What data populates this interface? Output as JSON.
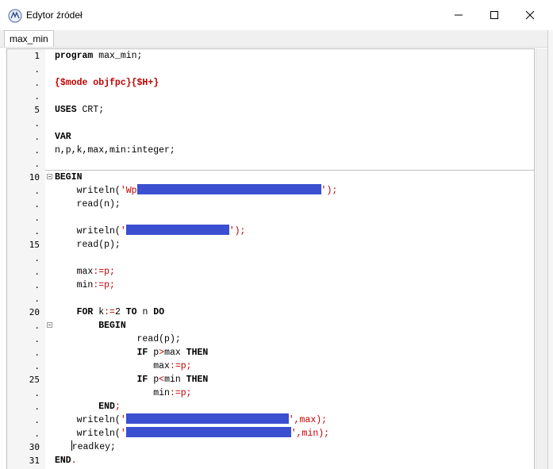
{
  "window": {
    "title": "Edytor źródeł",
    "tab": "max_min",
    "icon": "lazarus-icon"
  },
  "editor": {
    "line_numbers": [
      "1",
      ".",
      ".",
      ".",
      "5",
      ".",
      ".",
      ".",
      ".",
      "10",
      ".",
      ".",
      ".",
      ".",
      "15",
      ".",
      ".",
      ".",
      ".",
      "20",
      ".",
      ".",
      ".",
      ".",
      "25",
      ".",
      ".",
      ".",
      ".",
      "30",
      "31"
    ],
    "code": {
      "l1": {
        "kw": "program",
        "rest": " max_min;"
      },
      "l3": {
        "dir": "{$mode objfpc}{$H+}"
      },
      "l5": {
        "kw": "USES",
        "rest": " CRT;"
      },
      "l7": {
        "kw": "VAR"
      },
      "l8": {
        "a": "n,p,k,max,min",
        "b": ":integer;"
      },
      "l10": {
        "kw": "BEGIN"
      },
      "l11": {
        "a": "writeln(",
        "b": "'Wp",
        "c": "');"
      },
      "l12": {
        "a": "read(n);"
      },
      "l14": {
        "a": "writeln(",
        "b": "'",
        "c": "');"
      },
      "l15": {
        "a": "read(p);"
      },
      "l17": {
        "a": "max",
        "b": ":=p;"
      },
      "l18": {
        "a": "min",
        "b": ":=p;"
      },
      "l20": {
        "kw1": "FOR",
        "a": " k",
        "b": ":=",
        "c": "2 ",
        "kw2": "TO",
        "d": " n ",
        "kw3": "DO"
      },
      "l21": {
        "kw": "BEGIN"
      },
      "l22": {
        "a": "read(p);"
      },
      "l23": {
        "kw1": "IF",
        "a": " p",
        "b": ">",
        "c": "max ",
        "kw2": "THEN"
      },
      "l24": {
        "a": "max",
        "b": ":=p;"
      },
      "l25": {
        "kw1": "IF",
        "a": " p",
        "b": "<",
        "c": "min ",
        "kw2": "THEN"
      },
      "l26": {
        "a": "min",
        "b": ":=p;"
      },
      "l27": {
        "kw": "END",
        "rest": ";"
      },
      "l28": {
        "a": "writeln(",
        "b": "'",
        "c": "',max);"
      },
      "l29": {
        "a": "writeln(",
        "b": "'",
        "c": "',min);"
      },
      "l30": {
        "a": "readkey;"
      },
      "l31": {
        "kw": "END",
        "rest": "."
      }
    }
  }
}
